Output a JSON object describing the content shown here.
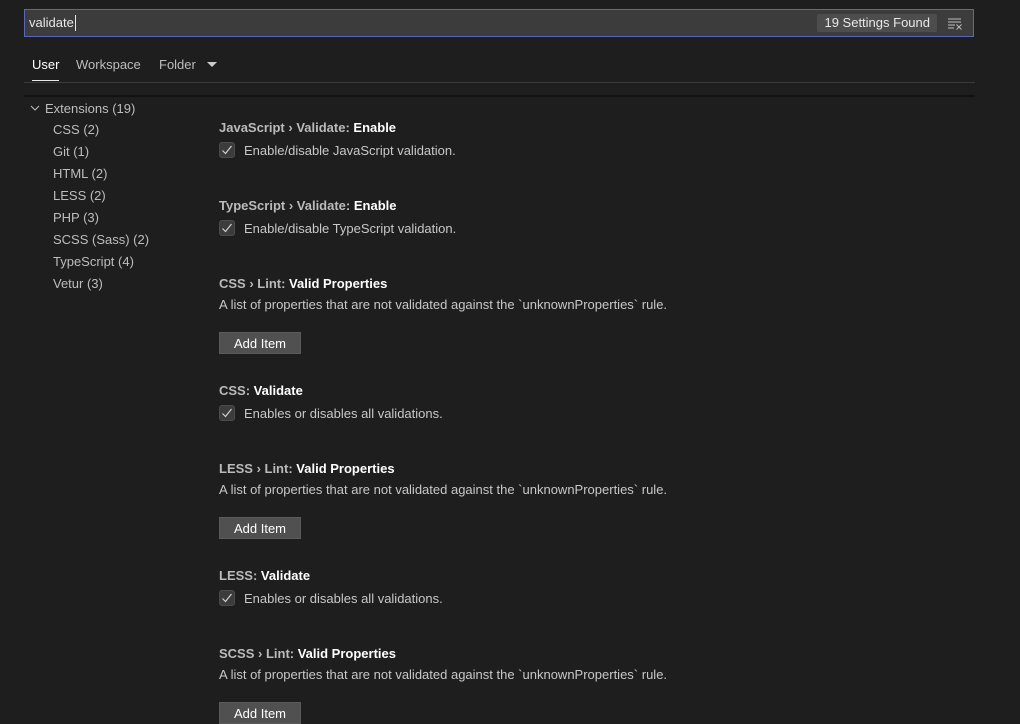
{
  "search": {
    "value": "validate",
    "results_count": "19 Settings Found"
  },
  "tabs": [
    {
      "label": "User"
    },
    {
      "label": "Workspace"
    },
    {
      "label": "Folder"
    }
  ],
  "toc": {
    "header": "Extensions (19)",
    "items": [
      {
        "label": "CSS (2)"
      },
      {
        "label": "Git (1)"
      },
      {
        "label": "HTML (2)"
      },
      {
        "label": "LESS (2)"
      },
      {
        "label": "PHP (3)"
      },
      {
        "label": "SCSS (Sass) (2)"
      },
      {
        "label": "TypeScript (4)"
      },
      {
        "label": "Vetur (3)"
      }
    ]
  },
  "settings": [
    {
      "prefix": "JavaScript › Validate: ",
      "name": "Enable",
      "description": "Enable/disable JavaScript validation.",
      "checked": true
    },
    {
      "prefix": "TypeScript › Validate: ",
      "name": "Enable",
      "description": "Enable/disable TypeScript validation.",
      "checked": true
    },
    {
      "prefix": "CSS › Lint: ",
      "name": "Valid Properties",
      "description": "A list of properties that are not validated against the `unknownProperties` rule.",
      "button": "Add Item"
    },
    {
      "prefix": "CSS: ",
      "name": "Validate",
      "description": "Enables or disables all validations.",
      "checked": true
    },
    {
      "prefix": "LESS › Lint: ",
      "name": "Valid Properties",
      "description": "A list of properties that are not validated against the `unknownProperties` rule.",
      "button": "Add Item"
    },
    {
      "prefix": "LESS: ",
      "name": "Validate",
      "description": "Enables or disables all validations.",
      "checked": true
    },
    {
      "prefix": "SCSS › Lint: ",
      "name": "Valid Properties",
      "description": "A list of properties that are not validated against the `unknownProperties` rule.",
      "button": "Add Item"
    }
  ],
  "colors": {
    "background": "#1e1e1e",
    "focus_border": "#5a67b8",
    "button": "#505050"
  },
  "icons": {
    "clear": "clear-filter-icon",
    "check": "check-icon",
    "chevron": "chevron-down-icon",
    "dropdown": "caret-down-icon"
  }
}
